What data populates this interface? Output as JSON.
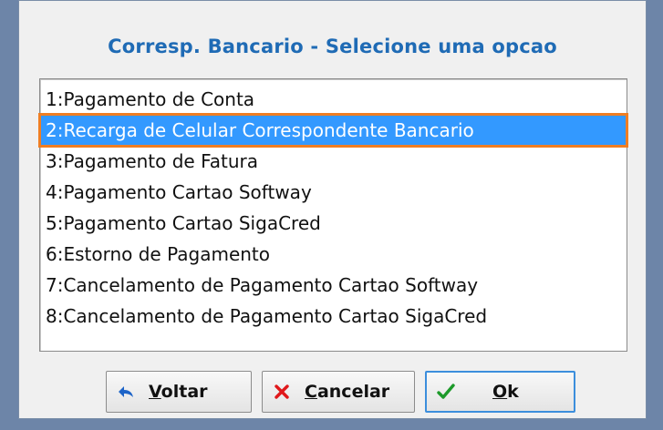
{
  "dialog": {
    "title": "Corresp. Bancario - Selecione uma opcao"
  },
  "options": [
    {
      "label": "1:Pagamento de Conta",
      "selected": false
    },
    {
      "label": "2:Recarga de Celular Correspondente Bancario",
      "selected": true
    },
    {
      "label": "3:Pagamento de Fatura",
      "selected": false
    },
    {
      "label": "4:Pagamento Cartao Softway",
      "selected": false
    },
    {
      "label": "5:Pagamento Cartao SigaCred",
      "selected": false
    },
    {
      "label": "6:Estorno de Pagamento",
      "selected": false
    },
    {
      "label": "7:Cancelamento de Pagamento Cartao Softway",
      "selected": false
    },
    {
      "label": "8:Cancelamento de Pagamento Cartao SigaCred",
      "selected": false
    }
  ],
  "buttons": {
    "voltar": {
      "mnemonic": "V",
      "rest": "oltar",
      "icon": "back-arrow-icon"
    },
    "cancelar": {
      "mnemonic": "C",
      "rest": "ancelar",
      "icon": "close-icon"
    },
    "ok": {
      "mnemonic": "O",
      "rest": "k",
      "icon": "checkmark-icon"
    }
  },
  "colors": {
    "title": "#1f6bb5",
    "selection": "#3399ff",
    "highlight_outline": "#f07e22"
  }
}
